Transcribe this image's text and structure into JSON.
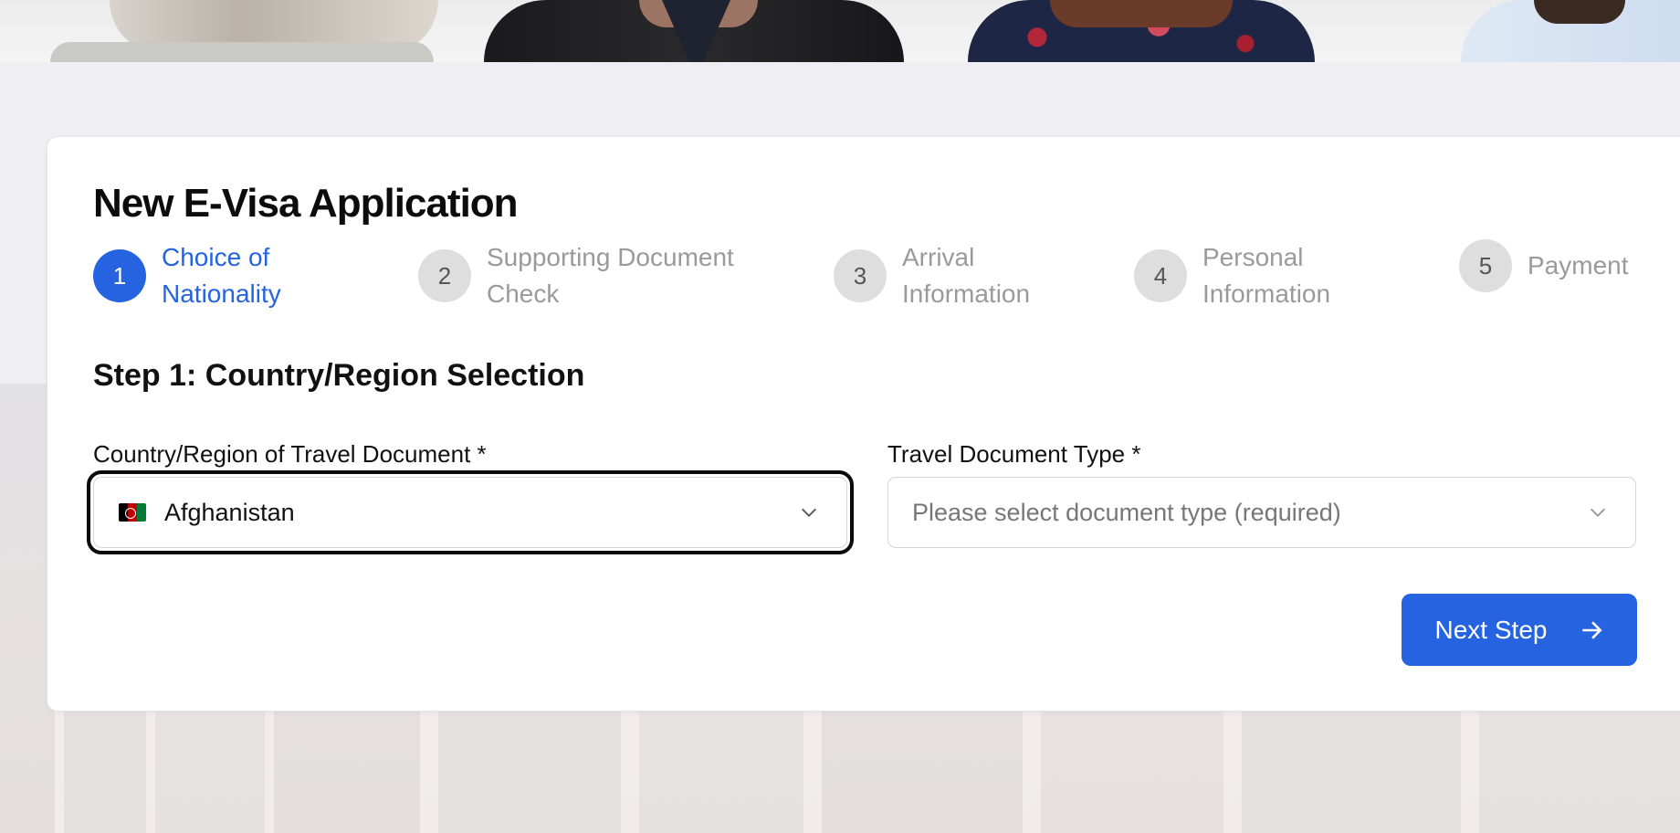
{
  "form": {
    "title": "New E-Visa Application",
    "steps": [
      {
        "number": "1",
        "label": "Choice of Nationality",
        "state": "active"
      },
      {
        "number": "2",
        "label": "Supporting Document Check",
        "state": "inactive"
      },
      {
        "number": "3",
        "label": "Arrival Information",
        "state": "inactive"
      },
      {
        "number": "4",
        "label": "Personal Information",
        "state": "inactive"
      },
      {
        "number": "5",
        "label": "Payment",
        "state": "inactive"
      }
    ],
    "section_title": "Step 1: Country/Region Selection",
    "country_field": {
      "label": "Country/Region of Travel Document *",
      "value": "Afghanistan",
      "flag_icon": "afghanistan-flag-icon"
    },
    "document_type_field": {
      "label": "Travel Document Type *",
      "placeholder": "Please select document type (required)"
    },
    "next_button": {
      "label": "Next Step",
      "icon": "arrow-right-icon"
    }
  },
  "colors": {
    "accent": "#2563e0",
    "inactive_step": "#dedede",
    "inactive_text": "#9a9a9a"
  }
}
